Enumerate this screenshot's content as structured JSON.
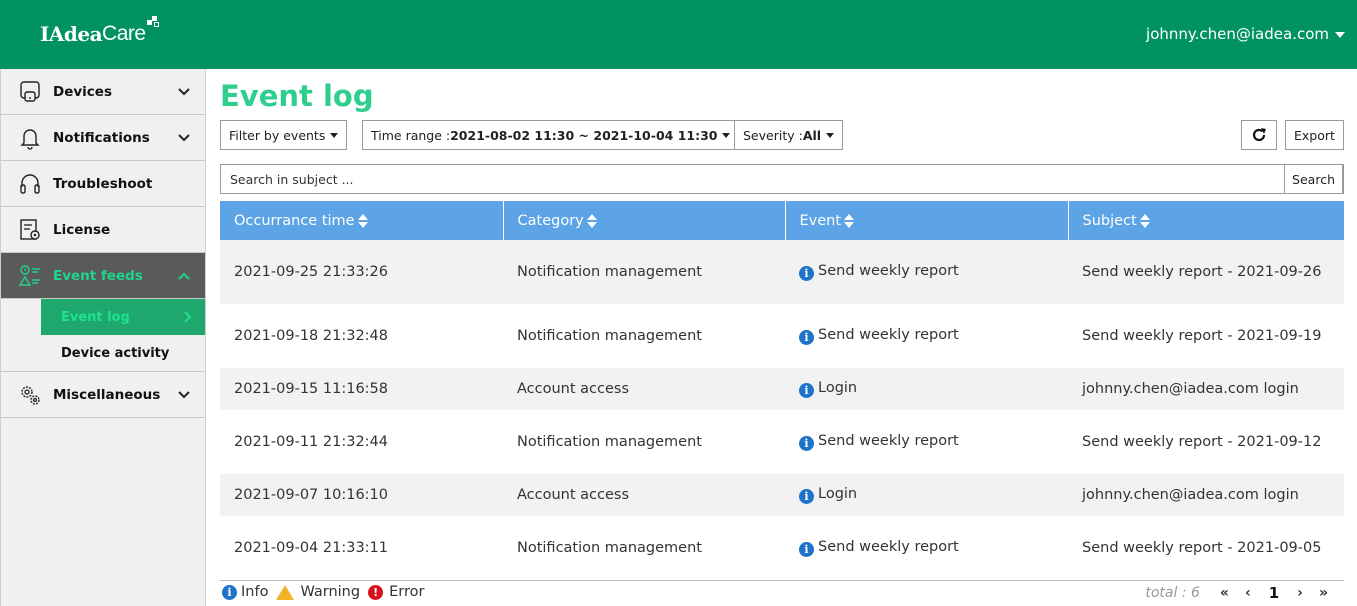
{
  "header": {
    "logo_text": "IAdea",
    "logo_suffix": "Care",
    "user_email": "johnny.chen@iadea.com"
  },
  "sidebar": {
    "items": [
      {
        "label": "Devices",
        "icon": "device-icon"
      },
      {
        "label": "Notifications",
        "icon": "bell-icon"
      },
      {
        "label": "Troubleshoot",
        "icon": "headset-icon"
      },
      {
        "label": "License",
        "icon": "license-icon"
      },
      {
        "label": "Event feeds",
        "icon": "event-feeds-icon"
      },
      {
        "label": "Miscellaneous",
        "icon": "gears-icon"
      }
    ],
    "sub_items": [
      {
        "label": "Event log"
      },
      {
        "label": "Device activity"
      }
    ]
  },
  "main": {
    "title": "Event log",
    "filter_label": "Filter by events",
    "time_range_label": "Time range : ",
    "time_range_value": "2021-08-02 11:30 ~ 2021-10-04 11:30",
    "severity_label": "Severity : ",
    "severity_value": "All",
    "export_label": "Export",
    "search_placeholder": "Search in subject ...",
    "search_button": "Search"
  },
  "table": {
    "headers": [
      "Occurrance time",
      "Category",
      "Event",
      "Subject"
    ],
    "rows": [
      {
        "time": "2021-09-25 21:33:26",
        "category": "Notification management",
        "event": "Send weekly report",
        "subject": "Send weekly report - 2021-09-26"
      },
      {
        "time": "2021-09-18 21:32:48",
        "category": "Notification management",
        "event": "Send weekly report",
        "subject": "Send weekly report - 2021-09-19"
      },
      {
        "time": "2021-09-15 11:16:58",
        "category": "Account access",
        "event": "Login",
        "subject": "johnny.chen@iadea.com login"
      },
      {
        "time": "2021-09-11 21:32:44",
        "category": "Notification management",
        "event": "Send weekly report",
        "subject": "Send weekly report - 2021-09-12"
      },
      {
        "time": "2021-09-07 10:16:10",
        "category": "Account access",
        "event": "Login",
        "subject": "johnny.chen@iadea.com login"
      },
      {
        "time": "2021-09-04 21:33:11",
        "category": "Notification management",
        "event": "Send weekly report",
        "subject": "Send weekly report - 2021-09-05"
      }
    ]
  },
  "footer": {
    "legend_info": "Info",
    "legend_warning": "Warning",
    "legend_error": "Error",
    "total_label": "total : 6",
    "first": "«",
    "prev": "‹",
    "page": "1",
    "next": "›",
    "last": "»"
  },
  "colors": {
    "brand_green": "#00935f",
    "title_green": "#2ecf8c",
    "table_header_blue": "#5ca4e6",
    "info_blue": "#1e73c8",
    "warning_yellow": "#f3b42a",
    "error_red": "#d3141d"
  }
}
